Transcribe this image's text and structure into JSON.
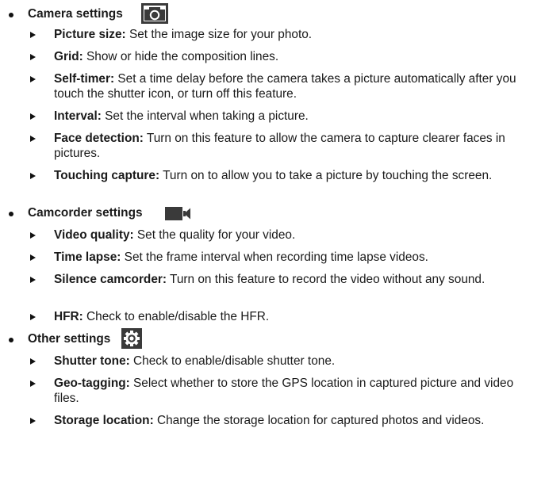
{
  "sections": [
    {
      "title": "Camera settings",
      "icon": "camera-icon",
      "items": [
        {
          "term": "Picture size:",
          "desc": " Set the image size for your photo."
        },
        {
          "term": "Grid:",
          "desc": " Show or hide the composition lines."
        },
        {
          "term": "Self-timer:",
          "desc": " Set a time delay before the camera takes a picture automatically after you touch the shutter icon, or turn off this feature."
        },
        {
          "term": "Interval:",
          "desc": " Set the interval when taking a picture."
        },
        {
          "term": "Face detection:",
          "desc": " Turn on this feature to allow the camera to capture clearer faces in pictures."
        },
        {
          "term": "Touching capture:",
          "desc": " Turn on to allow you to take a picture by touching the screen."
        }
      ]
    },
    {
      "title": "Camcorder settings",
      "icon": "video-camera-icon",
      "items": [
        {
          "term": "Video quality:",
          "desc": " Set the quality for your video."
        },
        {
          "term": "Time lapse:",
          "desc": " Set the frame interval when recording time lapse videos."
        },
        {
          "term": "Silence camcorder:",
          "desc": " Turn on this feature to record the video without any sound."
        },
        {
          "term": "HFR:",
          "desc": " Check to enable/disable the HFR."
        }
      ]
    },
    {
      "title": "Other settings",
      "icon": "gear-icon",
      "items": [
        {
          "term": "Shutter tone:",
          "desc": " Check to enable/disable shutter tone."
        },
        {
          "term": "Geo-tagging:",
          "desc": " Select whether to store the GPS location in captured picture and video files."
        },
        {
          "term": "Storage location:",
          "desc": " Change the storage location for captured photos and videos."
        }
      ]
    }
  ]
}
